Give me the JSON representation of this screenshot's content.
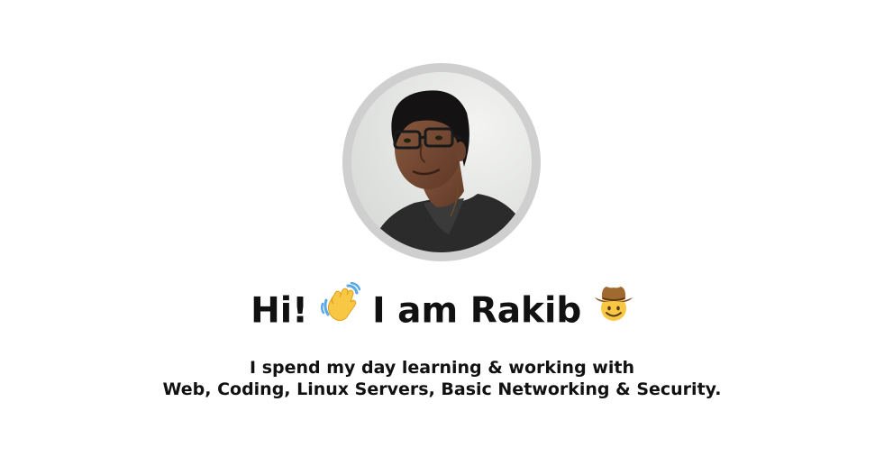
{
  "profile": {
    "avatar_alt": "Rakib profile photo"
  },
  "greeting": {
    "hi": "Hi!",
    "wave_emoji": "waving-hand-icon",
    "name_text": "I am Rakib",
    "cowboy_emoji": "cowboy-face-icon"
  },
  "bio": {
    "line1": "I spend my day learning & working with",
    "line2": "Web, Coding, Linux Servers, Basic Networking & Security."
  }
}
